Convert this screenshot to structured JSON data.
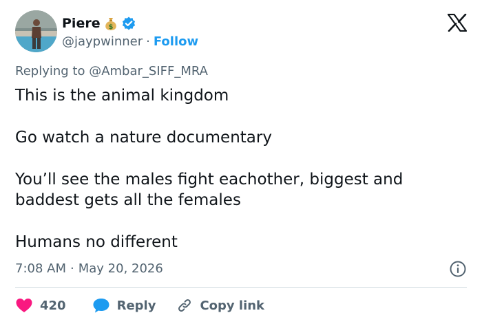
{
  "author": {
    "display_name": "Piere",
    "name_emoji": "money-bag",
    "verified": true,
    "handle": "@jaypwinner",
    "separator": "·",
    "follow_label": "Follow"
  },
  "reply_context": {
    "prefix": "Replying to ",
    "mention": "@Ambar_SIFF_MRA"
  },
  "tweet": {
    "lines": [
      "This is the animal kingdom",
      "Go watch a nature documentary",
      "You’ll see the males fight eachother, biggest and baddest gets all the females",
      "Humans no different"
    ]
  },
  "meta": {
    "time": "7:08 AM",
    "separator": "·",
    "date": "May 20, 2026"
  },
  "actions": {
    "like_count": "420",
    "reply_label": "Reply",
    "copy_link_label": "Copy link"
  },
  "icons": {
    "brand": "x-logo-icon",
    "info": "info-icon",
    "like": "heart-icon",
    "reply": "speech-bubble-icon",
    "copy": "link-icon"
  },
  "colors": {
    "accent": "#1d9bf0",
    "like": "#f91880",
    "secondary_text": "#536471",
    "primary_text": "#0f1419",
    "divider": "#cfd9de"
  }
}
